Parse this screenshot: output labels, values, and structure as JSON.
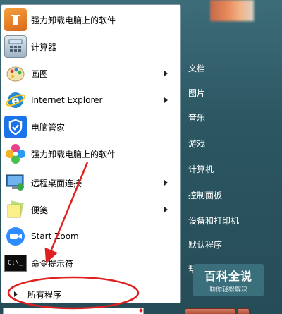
{
  "programs": [
    {
      "label": "强力卸载电脑上的软件",
      "icon": "recycle-icon",
      "arrow": false
    },
    {
      "label": "计算器",
      "icon": "calculator-icon",
      "arrow": false
    },
    {
      "label": "画图",
      "icon": "paint-icon",
      "arrow": true
    },
    {
      "label": "Internet Explorer",
      "icon": "ie-icon",
      "arrow": true
    },
    {
      "label": "电脑管家",
      "icon": "shield-icon",
      "arrow": false
    },
    {
      "label": "强力卸载电脑上的软件",
      "icon": "flower-icon",
      "arrow": false
    },
    {
      "label": "远程桌面连接",
      "icon": "remote-desktop-icon",
      "arrow": true
    },
    {
      "label": "便笺",
      "icon": "sticky-notes-icon",
      "arrow": true
    },
    {
      "label": "Start Zoom",
      "icon": "zoom-icon",
      "arrow": false
    },
    {
      "label": "命令提示符",
      "icon": "cmd-icon",
      "arrow": false
    }
  ],
  "all_programs": "所有程序",
  "right_links": [
    "文档",
    "图片",
    "音乐",
    "游戏",
    "计算机",
    "控制面板",
    "设备和打印机",
    "默认程序",
    "帮"
  ],
  "watermark": {
    "title": "百科全说",
    "subtitle": "助你轻松解决"
  },
  "colors": {
    "annotation": "#e02020",
    "menu_bg": "#2b5662"
  }
}
